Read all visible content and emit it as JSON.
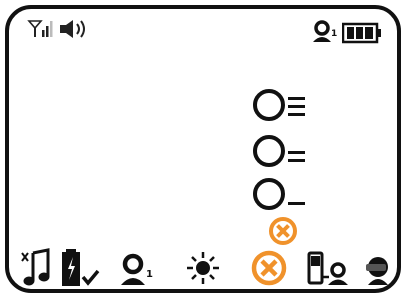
{
  "status": {
    "left_icons": [
      "signal-icon",
      "speaker-icon"
    ],
    "right_icons": [
      "sensor-icon",
      "battery-icon"
    ],
    "sensor_index": "1"
  },
  "levels": [
    {
      "name": "level-high",
      "bars": 3
    },
    {
      "name": "level-medium",
      "bars": 2
    },
    {
      "name": "level-low",
      "bars": 1
    }
  ],
  "alerts": [
    "x-circle-icon",
    "x-circle-icon"
  ],
  "bottom_bar": {
    "icons": [
      "music-icon",
      "battery-check-icon",
      "sensor-icon",
      "brightness-icon",
      "x-circle-icon",
      "phone-sensor-icon",
      "head-icon"
    ],
    "sensor_index": "1"
  },
  "colors": {
    "foreground": "#111111",
    "alert_orange": "#f0922b"
  }
}
